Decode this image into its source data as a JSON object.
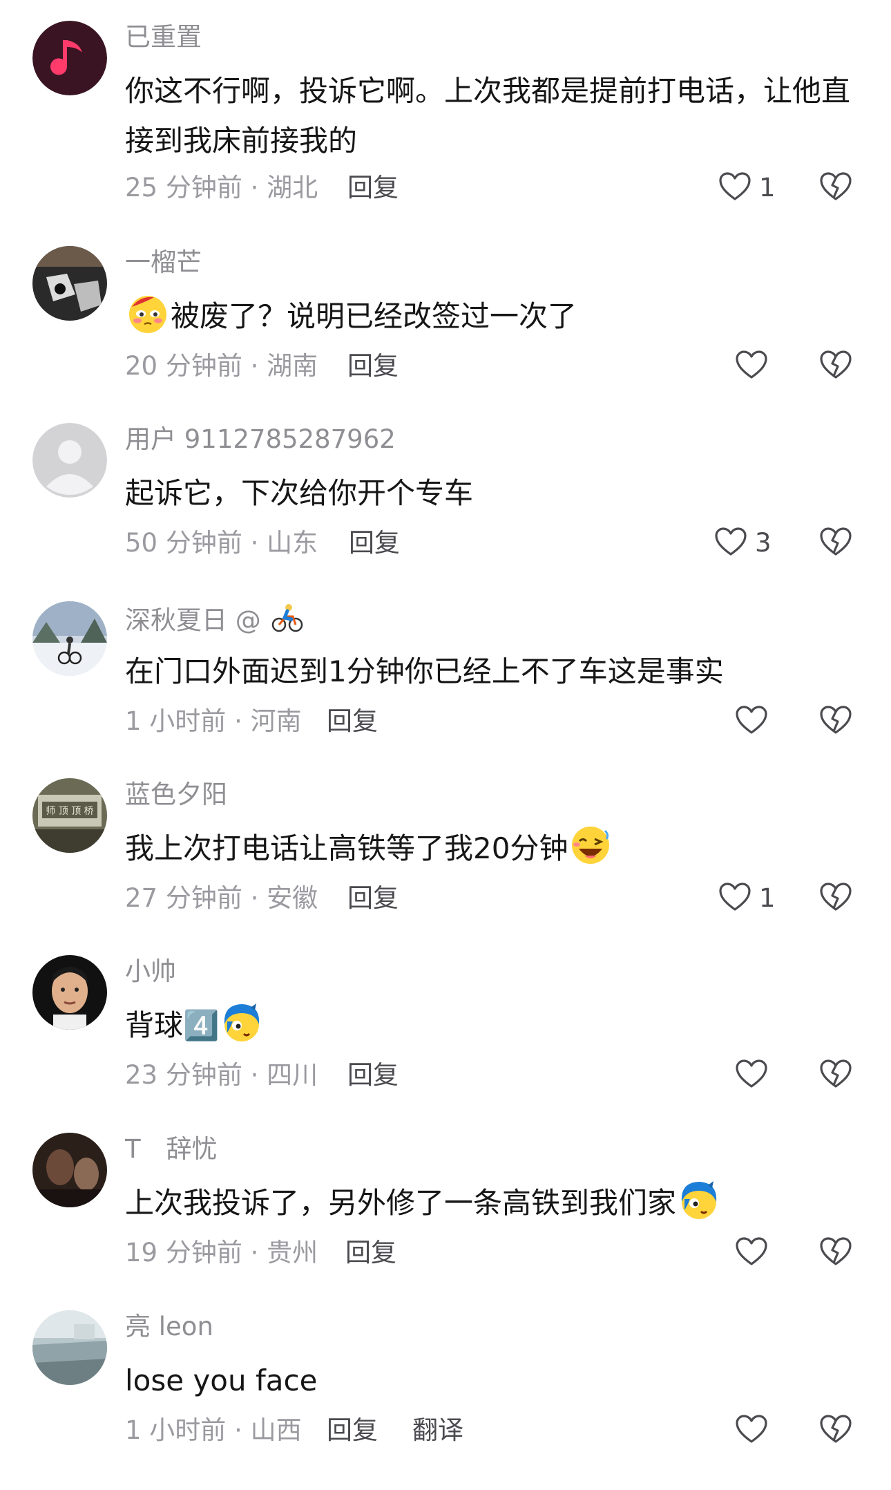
{
  "comments": [
    {
      "username": "已重置",
      "text": "你这不行啊，投诉它啊。上次我都是提前打电话，让他直接到我床前接我的",
      "time": "25 分钟前",
      "location": "湖北",
      "reply_label": "回复",
      "likes": "1",
      "avatar_icon": "music-note-app-avatar"
    },
    {
      "username": "一榴芒",
      "text": "被废了？说明已经改签过一次了",
      "emoji_before": "flushed-face-emoji",
      "time": "20 分钟前",
      "location": "湖南",
      "reply_label": "回复",
      "likes": ""
    },
    {
      "username": "用户 9112785287962",
      "text": "起诉它，下次给你开个专车",
      "time": "50 分钟前",
      "location": "山东",
      "reply_label": "回复",
      "likes": "3",
      "avatar_icon": "default-user-avatar"
    },
    {
      "username": "深秋夏日",
      "username_suffix": "@",
      "username_icon": "cyclist-emoji",
      "text": "在门口外面迟到1分钟你已经上不了车这是事实",
      "time": "1 小时前",
      "location": "河南",
      "reply_label": "回复",
      "likes": ""
    },
    {
      "username": "蓝色夕阳",
      "text": "我上次打电话让高铁等了我20分钟",
      "emoji_after": "laughing-wink-emoji",
      "time": "27 分钟前",
      "location": "安徽",
      "reply_label": "回复",
      "likes": "1"
    },
    {
      "username": "小帅",
      "text": "背球4️⃣",
      "emoji_after": "blue-hair-face-emoji",
      "time": "23 分钟前",
      "location": "四川",
      "reply_label": "回复",
      "likes": ""
    },
    {
      "username": "T　辞忧",
      "text": "上次我投诉了，另外修了一条高铁到我们家",
      "emoji_after": "blue-hair-face-emoji",
      "time": "19 分钟前",
      "location": "贵州",
      "reply_label": "回复",
      "likes": ""
    },
    {
      "username": "亮 leon",
      "text": "lose you face",
      "time": "1 小时前",
      "location": "山西",
      "reply_label": "回复",
      "translate_label": "翻译",
      "likes": ""
    }
  ],
  "icons": {
    "like": "heart-outline-icon",
    "dislike": "broken-heart-outline-icon"
  },
  "colors": {
    "username": "#8e8e93",
    "text": "#161616",
    "meta": "#9a9aa0",
    "action": "#4a4a4f"
  }
}
